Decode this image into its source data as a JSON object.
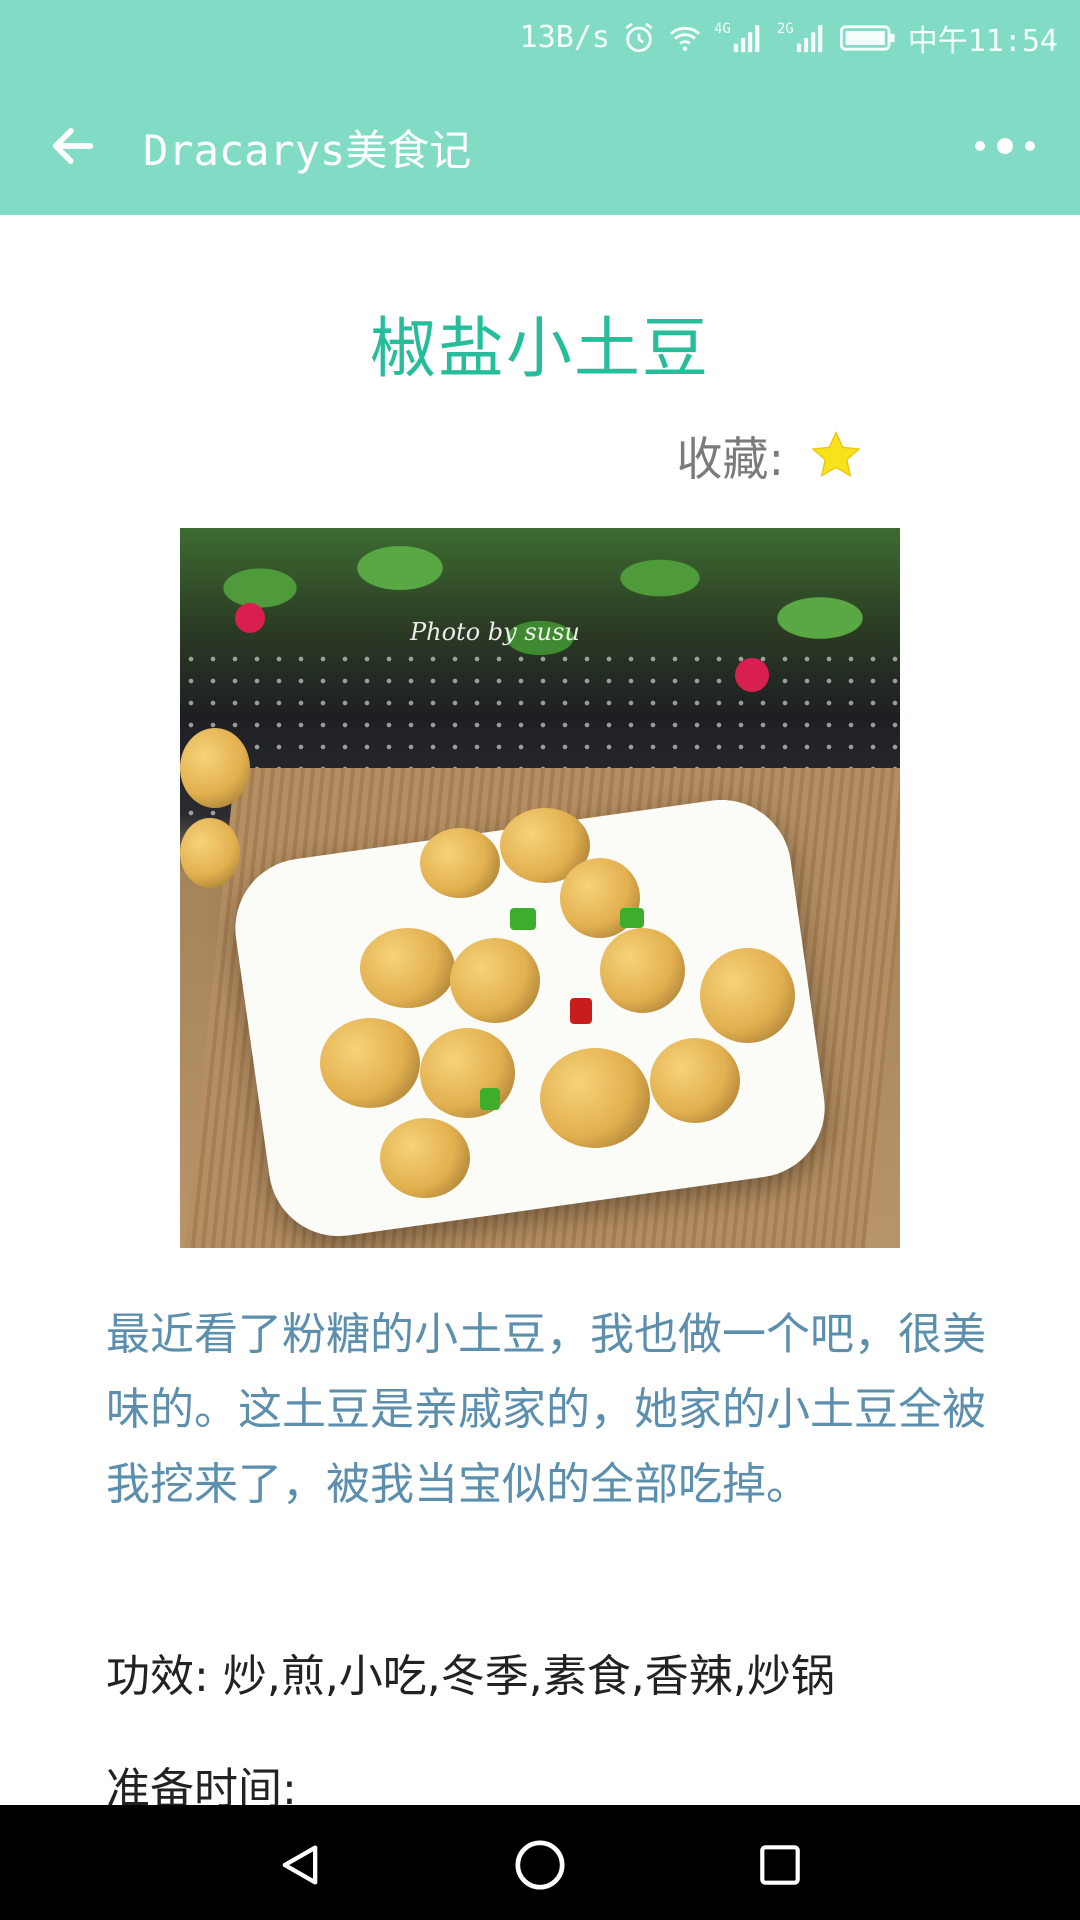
{
  "status_bar": {
    "speed": "13B/s",
    "net_4g": "4G",
    "net_2g": "2G",
    "time": "中午11:54",
    "icons": [
      "alarm-icon",
      "wifi-icon",
      "signal-4g-icon",
      "signal-2g-icon",
      "battery-icon"
    ]
  },
  "toolbar": {
    "title": "Dracarys美食记",
    "back_icon": "arrow-left-icon",
    "more_icon": "more-dots-icon",
    "color": "#82dbc5"
  },
  "recipe": {
    "title": "椒盐小土豆",
    "favorite_label": "收藏:",
    "favorite_icon": "star-icon",
    "photo_watermark": "Photo by susu",
    "description": "最近看了粉糖的小土豆，我也做一个吧，很美味的。这土豆是亲戚家的，她家的小土豆全被我挖来了，被我当宝似的全部吃掉。",
    "effects_label": "功效:",
    "effects_value": "炒,煎,小吃,冬季,素食,香辣,炒锅",
    "prep_label": "准备时间:",
    "title_color": "#27bd9b",
    "description_color": "#5b8fad"
  },
  "nav_bar": {
    "icons": [
      "back-triangle-icon",
      "home-circle-icon",
      "recents-square-icon"
    ]
  }
}
